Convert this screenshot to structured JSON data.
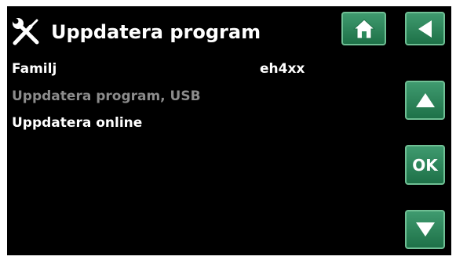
{
  "header": {
    "title": "Uppdatera program",
    "icon": "tools-icon"
  },
  "menu": {
    "items": [
      {
        "label": "Familj",
        "value": "eh4xx",
        "enabled": true
      },
      {
        "label": "Uppdatera program, USB",
        "enabled": false
      },
      {
        "label": "Uppdatera online",
        "enabled": true
      }
    ]
  },
  "nav": {
    "home_icon": "home-icon",
    "back_icon": "back-arrow-icon",
    "up_icon": "up-arrow-icon",
    "ok_label": "OK",
    "down_icon": "down-arrow-icon"
  },
  "colors": {
    "background": "#000000",
    "button_green": "#2b8a5c",
    "text": "#ffffff",
    "disabled_text": "#8c8c8c"
  }
}
